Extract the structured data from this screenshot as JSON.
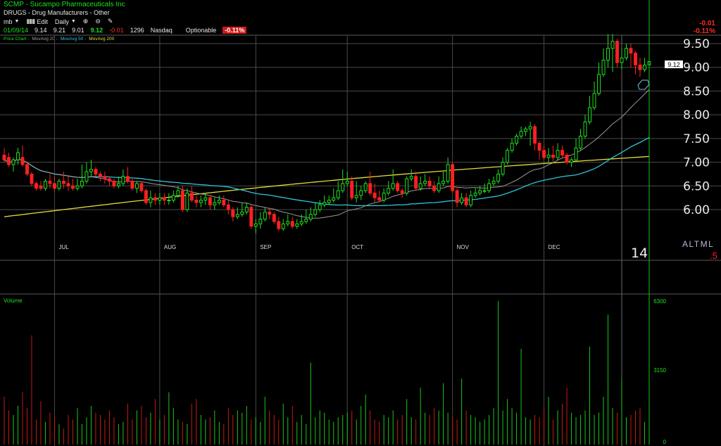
{
  "header": {
    "title": "SCMP - Sucampo Pharmaceuticals Inc",
    "industry": "DRUGS - Drug Manufacturers - Other",
    "toolbar": {
      "profile": "mb",
      "edit_label": "Edit",
      "period": "Daily"
    },
    "quote": {
      "date": "01/09/14",
      "open": "9.14",
      "high": "9.21",
      "low": "9.01",
      "close": "9.12",
      "change": "-0.01",
      "volume": "1296",
      "exchange": "Nasdaq",
      "optionable": "Optionable",
      "change_pct": "-0.11%"
    },
    "legend": {
      "price": "Price Chart -",
      "ma20": "MovAvg 20 -",
      "ma50": "MovAvg 50 -",
      "ma200": "MovAvg 200"
    },
    "right_change": "-0.01",
    "right_change_pct": "-0.11%"
  },
  "badges": {
    "last_price": "9.12",
    "year": "14",
    "right_tag": "ALTML",
    "right_small": ".5"
  },
  "colors": {
    "up": "#1fe01f",
    "down": "#ff2020",
    "ma20": "#9a9a9a",
    "ma50": "#2fc4d6",
    "ma200": "#e4dc38",
    "grid": "#4a4a4a"
  },
  "chart_data": {
    "type": "candlestick",
    "x": [
      "06/14",
      "06/17",
      "06/18",
      "06/19",
      "06/20",
      "06/21",
      "06/24",
      "06/25",
      "06/26",
      "06/27",
      "06/28",
      "07/01",
      "07/02",
      "07/03",
      "07/05",
      "07/08",
      "07/09",
      "07/10",
      "07/11",
      "07/12",
      "07/15",
      "07/16",
      "07/17",
      "07/18",
      "07/19",
      "07/22",
      "07/23",
      "07/24",
      "07/25",
      "07/26",
      "07/29",
      "07/30",
      "07/31",
      "08/01",
      "08/02",
      "08/05",
      "08/06",
      "08/07",
      "08/08",
      "08/09",
      "08/12",
      "08/13",
      "08/14",
      "08/15",
      "08/16",
      "08/19",
      "08/20",
      "08/21",
      "08/22",
      "08/23",
      "08/26",
      "08/27",
      "08/28",
      "08/29",
      "08/30",
      "09/03",
      "09/04",
      "09/05",
      "09/06",
      "09/09",
      "09/10",
      "09/11",
      "09/12",
      "09/13",
      "09/16",
      "09/17",
      "09/18",
      "09/19",
      "09/20",
      "09/23",
      "09/24",
      "09/25",
      "09/26",
      "09/27",
      "09/30",
      "10/01",
      "10/02",
      "10/03",
      "10/04",
      "10/07",
      "10/08",
      "10/09",
      "10/10",
      "10/11",
      "10/14",
      "10/15",
      "10/16",
      "10/17",
      "10/18",
      "10/21",
      "10/22",
      "10/23",
      "10/24",
      "10/25",
      "10/28",
      "10/29",
      "10/30",
      "10/31",
      "11/01",
      "11/04",
      "11/05",
      "11/06",
      "11/07",
      "11/08",
      "11/11",
      "11/12",
      "11/13",
      "11/14",
      "11/15",
      "11/18",
      "11/19",
      "11/20",
      "11/21",
      "11/22",
      "11/25",
      "11/26",
      "11/27",
      "11/29",
      "12/02",
      "12/03",
      "12/04",
      "12/05",
      "12/06",
      "12/09",
      "12/10",
      "12/11",
      "12/12",
      "12/13",
      "12/16",
      "12/17",
      "12/18",
      "12/19",
      "12/20",
      "12/23",
      "12/24",
      "12/26",
      "12/27",
      "12/30",
      "12/31",
      "01/02",
      "01/03",
      "01/06",
      "01/07",
      "01/08",
      "01/09"
    ],
    "open": [
      7.15,
      7.1,
      6.95,
      7.05,
      7.1,
      6.95,
      6.75,
      6.55,
      6.5,
      6.45,
      6.6,
      6.55,
      6.45,
      6.6,
      6.55,
      6.5,
      6.45,
      6.5,
      6.6,
      6.8,
      6.85,
      6.75,
      6.7,
      6.65,
      6.6,
      6.5,
      6.55,
      6.7,
      6.6,
      6.45,
      6.55,
      6.4,
      6.15,
      6.25,
      6.2,
      6.25,
      6.2,
      6.2,
      6.3,
      6.4,
      6.0,
      6.35,
      6.2,
      6.15,
      6.2,
      6.25,
      6.1,
      6.15,
      6.2,
      6.1,
      6.0,
      5.85,
      5.9,
      5.95,
      6.05,
      5.65,
      5.7,
      5.8,
      5.95,
      5.9,
      5.75,
      5.6,
      5.7,
      5.75,
      5.65,
      5.7,
      5.75,
      5.8,
      5.9,
      6.0,
      6.1,
      6.15,
      6.2,
      6.25,
      6.4,
      6.55,
      6.6,
      6.25,
      6.3,
      6.4,
      6.55,
      6.35,
      6.25,
      6.2,
      6.35,
      6.45,
      6.55,
      6.4,
      6.35,
      6.65,
      6.7,
      6.45,
      6.55,
      6.6,
      6.5,
      6.4,
      6.55,
      6.6,
      6.95,
      6.4,
      6.15,
      6.25,
      6.1,
      6.3,
      6.35,
      6.4,
      6.4,
      6.55,
      6.6,
      6.75,
      7.0,
      7.25,
      7.4,
      7.55,
      7.65,
      7.7,
      7.75,
      7.4,
      7.25,
      7.1,
      7.15,
      7.1,
      7.25,
      7.15,
      7.0,
      7.05,
      7.3,
      7.55,
      7.85,
      8.15,
      8.45,
      8.85,
      9.15,
      9.4,
      9.55,
      9.1,
      9.2,
      9.4,
      9.3,
      9.05,
      8.95,
      9.05
    ],
    "high": [
      7.3,
      7.2,
      7.1,
      7.3,
      7.35,
      7.0,
      6.8,
      6.6,
      6.6,
      6.65,
      6.75,
      6.7,
      6.65,
      6.8,
      6.7,
      6.65,
      6.65,
      6.95,
      7.0,
      7.05,
      6.9,
      6.8,
      6.8,
      6.7,
      6.65,
      6.7,
      6.85,
      6.9,
      6.65,
      6.6,
      6.6,
      6.45,
      6.4,
      6.35,
      6.35,
      6.35,
      6.35,
      6.4,
      6.5,
      6.5,
      6.45,
      6.5,
      6.3,
      6.3,
      6.35,
      6.3,
      6.25,
      6.3,
      6.3,
      6.2,
      6.05,
      6.05,
      6.15,
      6.15,
      6.1,
      5.8,
      5.95,
      6.05,
      6.05,
      5.95,
      5.85,
      5.8,
      5.9,
      5.85,
      5.8,
      5.9,
      6.0,
      6.05,
      6.15,
      6.2,
      6.3,
      6.3,
      6.45,
      6.6,
      6.85,
      6.8,
      6.7,
      6.6,
      6.5,
      6.6,
      6.8,
      6.55,
      6.4,
      6.45,
      6.6,
      6.85,
      6.6,
      6.45,
      6.7,
      6.85,
      6.8,
      6.7,
      6.75,
      6.7,
      6.6,
      6.7,
      6.8,
      7.1,
      7.0,
      6.45,
      6.35,
      6.35,
      6.4,
      6.45,
      6.5,
      6.55,
      6.65,
      6.7,
      6.85,
      7.1,
      7.3,
      7.5,
      7.6,
      7.75,
      7.75,
      7.85,
      7.8,
      7.45,
      7.35,
      7.3,
      7.35,
      7.4,
      7.35,
      7.2,
      7.1,
      7.5,
      7.7,
      8.0,
      8.4,
      8.7,
      9.1,
      9.4,
      9.7,
      9.7,
      9.6,
      9.4,
      9.5,
      9.5,
      9.35,
      9.2,
      9.2,
      9.21
    ],
    "low": [
      7.0,
      6.9,
      6.8,
      6.95,
      6.9,
      6.7,
      6.5,
      6.4,
      6.4,
      6.4,
      6.45,
      6.4,
      6.4,
      6.45,
      6.4,
      6.4,
      6.4,
      6.45,
      6.55,
      6.7,
      6.7,
      6.6,
      6.55,
      6.5,
      6.45,
      6.45,
      6.5,
      6.55,
      6.4,
      6.35,
      6.35,
      6.1,
      6.05,
      6.1,
      6.1,
      6.1,
      6.1,
      6.15,
      6.25,
      5.95,
      5.95,
      6.15,
      6.05,
      6.05,
      6.1,
      6.0,
      6.0,
      6.1,
      6.05,
      5.9,
      5.75,
      5.8,
      5.85,
      5.9,
      5.6,
      5.5,
      5.6,
      5.75,
      5.8,
      5.7,
      5.55,
      5.55,
      5.65,
      5.6,
      5.6,
      5.65,
      5.7,
      5.75,
      5.85,
      5.95,
      6.05,
      6.1,
      6.15,
      6.2,
      6.35,
      6.5,
      6.2,
      6.15,
      6.2,
      6.35,
      6.3,
      6.15,
      6.15,
      6.15,
      6.3,
      6.4,
      6.35,
      6.25,
      6.3,
      6.6,
      6.4,
      6.4,
      6.5,
      6.45,
      6.35,
      6.35,
      6.5,
      6.55,
      6.35,
      6.05,
      6.1,
      6.05,
      6.05,
      6.25,
      6.3,
      6.35,
      6.35,
      6.5,
      6.55,
      6.7,
      6.95,
      7.2,
      7.35,
      7.5,
      7.55,
      7.35,
      7.25,
      7.05,
      7.05,
      7.0,
      7.0,
      7.05,
      7.1,
      6.95,
      6.9,
      7.0,
      7.25,
      7.5,
      7.8,
      8.1,
      8.4,
      8.8,
      9.0,
      8.9,
      9.0,
      8.95,
      9.15,
      9.0,
      8.85,
      8.8,
      8.9,
      9.01
    ],
    "close": [
      7.05,
      6.95,
      7.05,
      7.2,
      6.95,
      6.75,
      6.55,
      6.45,
      6.45,
      6.6,
      6.55,
      6.45,
      6.6,
      6.55,
      6.5,
      6.45,
      6.5,
      6.6,
      6.8,
      6.85,
      6.75,
      6.7,
      6.65,
      6.6,
      6.5,
      6.55,
      6.7,
      6.6,
      6.45,
      6.55,
      6.4,
      6.15,
      6.25,
      6.2,
      6.25,
      6.2,
      6.2,
      6.3,
      6.4,
      6.0,
      6.35,
      6.2,
      6.15,
      6.2,
      6.25,
      6.1,
      6.15,
      6.2,
      6.1,
      6.0,
      5.85,
      5.9,
      5.95,
      6.05,
      5.65,
      5.7,
      5.8,
      5.95,
      5.9,
      5.75,
      5.6,
      5.7,
      5.75,
      5.65,
      5.7,
      5.75,
      5.8,
      5.9,
      6.0,
      6.1,
      6.15,
      6.2,
      6.25,
      6.4,
      6.55,
      6.6,
      6.25,
      6.3,
      6.4,
      6.55,
      6.35,
      6.25,
      6.2,
      6.35,
      6.45,
      6.55,
      6.4,
      6.35,
      6.65,
      6.7,
      6.45,
      6.55,
      6.6,
      6.5,
      6.4,
      6.55,
      6.6,
      6.95,
      6.4,
      6.15,
      6.25,
      6.1,
      6.3,
      6.35,
      6.4,
      6.4,
      6.55,
      6.6,
      6.75,
      7.0,
      7.25,
      7.4,
      7.55,
      7.65,
      7.7,
      7.75,
      7.4,
      7.25,
      7.1,
      7.15,
      7.1,
      7.25,
      7.15,
      7.0,
      7.05,
      7.3,
      7.55,
      7.85,
      8.15,
      8.45,
      8.85,
      9.15,
      9.4,
      9.55,
      9.1,
      9.2,
      9.4,
      9.3,
      9.05,
      8.95,
      9.05,
      9.12
    ],
    "volume": [
      2100,
      1500,
      1300,
      1700,
      2300,
      1600,
      4800,
      1100,
      1900,
      1000,
      1400,
      1200,
      900,
      700,
      1300,
      1100,
      1600,
      900,
      1200,
      1700,
      1400,
      1300,
      1100,
      1500,
      1200,
      900,
      1000,
      1800,
      1100,
      1500,
      1700,
      1200,
      1400,
      2000,
      1100,
      1300,
      2300,
      1600,
      1100,
      1000,
      900,
      1800,
      2000,
      1300,
      1100,
      1200,
      1500,
      1000,
      900,
      1600,
      1300,
      1500,
      1400,
      1700,
      1100,
      1200,
      1000,
      2100,
      1500,
      1300,
      1100,
      1800,
      1200,
      1700,
      1000,
      1300,
      900,
      3600,
      1200,
      1500,
      1400,
      1100,
      1000,
      1200,
      1300,
      1400,
      1500,
      1100,
      1700,
      2200,
      1500,
      1100,
      1000,
      1300,
      1200,
      1500,
      1100,
      1300,
      2000,
      1200,
      1100,
      2500,
      1400,
      1300,
      1600,
      1500,
      2700,
      1400,
      1200,
      1100,
      2900,
      1500,
      1300,
      1200,
      1000,
      1100,
      1300,
      1600,
      6300,
      1500,
      2000,
      1600,
      1400,
      4200,
      1200,
      1100,
      1300,
      1200,
      1600,
      2100,
      1100,
      1500,
      1800,
      2500,
      1400,
      1200,
      1300,
      1500,
      4300,
      1300,
      1400,
      2100,
      5700,
      1600,
      1400,
      2900,
      1200,
      1300,
      1500,
      1600,
      1000
    ],
    "y_axis_labels": [
      "9.50",
      "9.00",
      "8.50",
      "8.00",
      "7.50",
      "7.00",
      "6.50",
      "6.00"
    ],
    "ylim": [
      5.5,
      9.75
    ],
    "months": [
      {
        "label": "JUL",
        "index": 11
      },
      {
        "label": "AUG",
        "index": 34
      },
      {
        "label": "SEP",
        "index": 55
      },
      {
        "label": "OCT",
        "index": 75
      },
      {
        "label": "NOV",
        "index": 98
      },
      {
        "label": "DEC",
        "index": 118
      }
    ],
    "year_marker": {
      "label": "14",
      "index": 139
    },
    "volume_axis": {
      "label": "Volume",
      "ticks": [
        "6300",
        "3150",
        "0"
      ],
      "max": 6300
    },
    "ma_labels": [
      "MovAvg 20",
      "MovAvg 50",
      "MovAvg 200"
    ]
  }
}
